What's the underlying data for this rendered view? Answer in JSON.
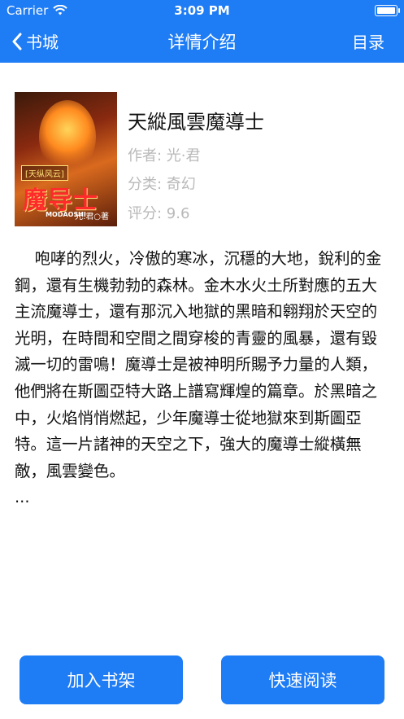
{
  "status_bar": {
    "carrier": "Carrier",
    "time": "3:09 PM"
  },
  "nav": {
    "back_label": "书城",
    "title": "详情介绍",
    "toc_label": "目录"
  },
  "cover": {
    "badge": "[天纵风云]",
    "title": "魔导士",
    "subtitle": "MODAOSHI",
    "author_mark": "光.君○著"
  },
  "book": {
    "title": "天縱風雲魔導士",
    "author": "作者: 光·君",
    "category": "分类: 奇幻",
    "rating": "评分: 9.6",
    "description": "    咆哮的烈火，冷傲的寒冰，沉穩的大地，銳利的金鋼，還有生機勃勃的森林。金木水火土所對應的五大主流魔導士，還有那沉入地獄的黑暗和翱翔於天空的光明，在時間和空間之間穿梭的青靈的風暴，還有毀滅一切的雷鳴！魔導士是被神明所賜予力量的人類，他們將在斯圖亞特大路上譜寫輝煌的篇章。於黑暗之中，火焰悄悄燃起，少年魔導士從地獄來到斯圖亞特。這一片諸神的天空之下，強大的魔導士縱橫無敵，風雲變色。\n..."
  },
  "actions": {
    "add_shelf": "加入书架",
    "quick_read": "快速阅读"
  },
  "colors": {
    "accent": "#1e7cf5",
    "meta_text": "#b9b9b9"
  }
}
